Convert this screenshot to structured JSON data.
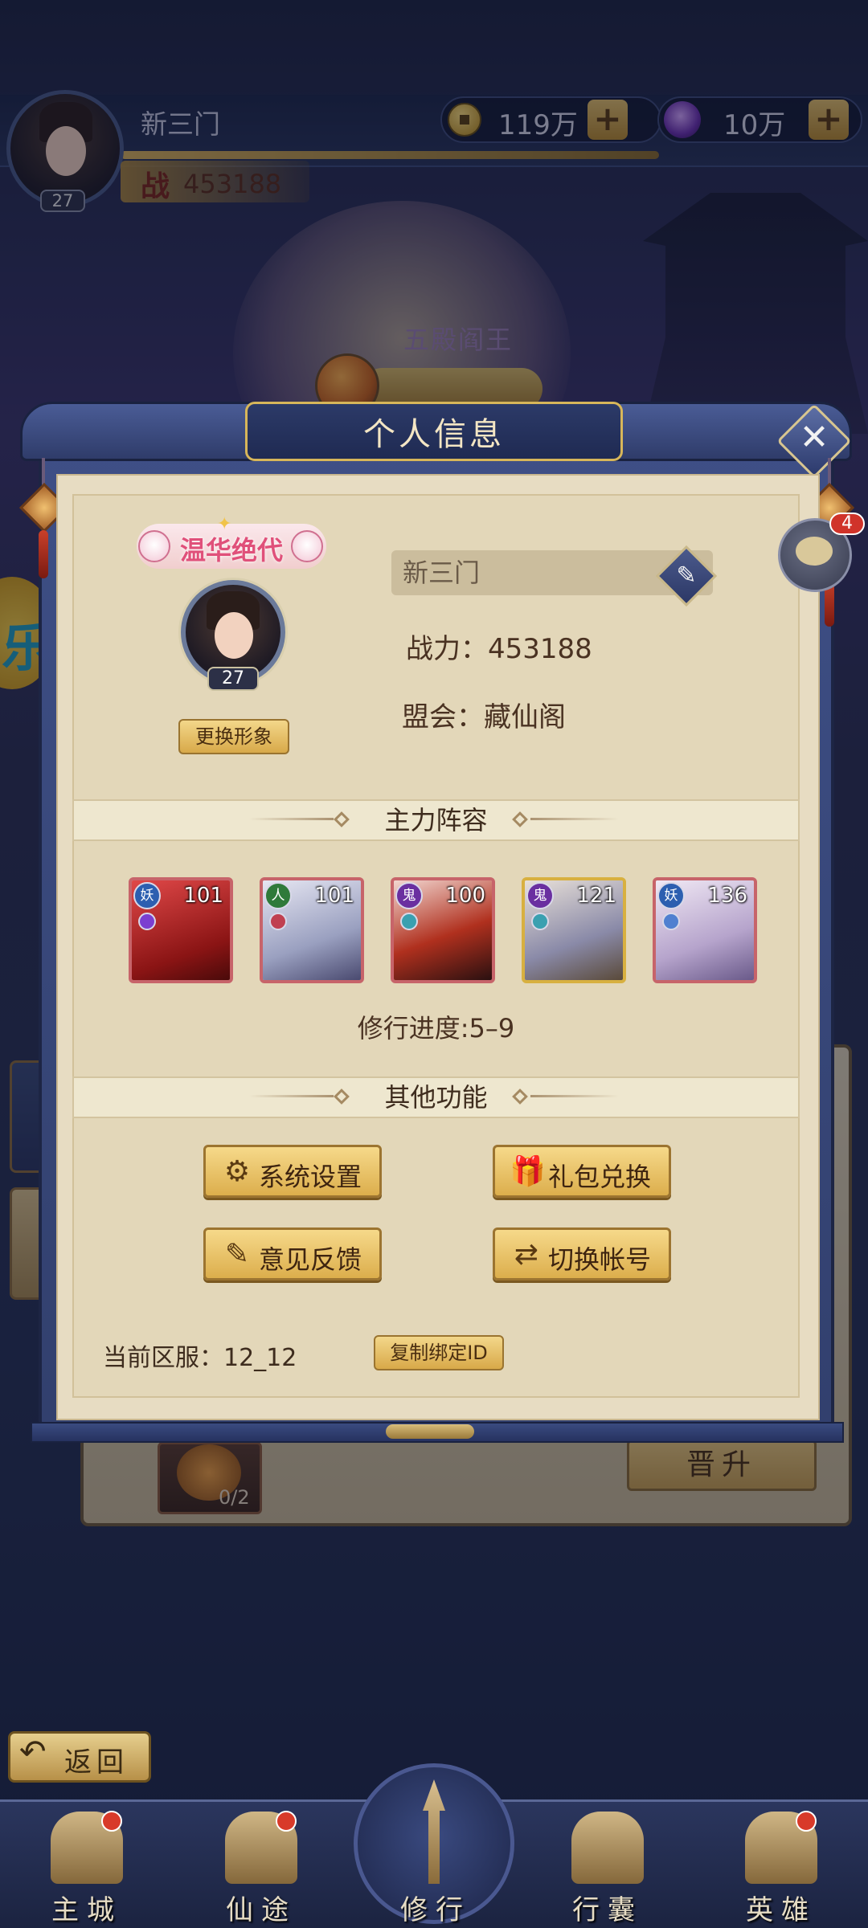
{
  "header": {
    "player_name": "新三门",
    "player_level": "27",
    "power_label": "战",
    "power_value": "453188",
    "coins": "119万",
    "gems": "10万",
    "plus": "+"
  },
  "background": {
    "boss_name": "五殿阎王",
    "plus_slot_count": "0/2",
    "promote_label": "晋升"
  },
  "modal": {
    "title": "个人信息",
    "close": "✕",
    "chat_badge_count": "4",
    "profile": {
      "title_badge": "温华绝代",
      "level": "27",
      "change_look": "更换形象",
      "name": "新三门",
      "power_line": "战力：453188",
      "guild_line": "盟会：藏仙阁"
    },
    "lineup": {
      "header": "主力阵容",
      "heroes": [
        {
          "level": "101",
          "faction": "妖",
          "faction_color": "#2c5fb0",
          "frame": "red"
        },
        {
          "level": "101",
          "faction": "人",
          "faction_color": "#2f7a3a",
          "frame": "red"
        },
        {
          "level": "100",
          "faction": "鬼",
          "faction_color": "#6a2fa0",
          "frame": "red"
        },
        {
          "level": "121",
          "faction": "鬼",
          "faction_color": "#6a2fa0",
          "frame": "gold"
        },
        {
          "level": "136",
          "faction": "妖",
          "faction_color": "#2c5fb0",
          "frame": "red"
        }
      ],
      "progress": "修行进度:5–9"
    },
    "other": {
      "header": "其他功能",
      "buttons": [
        {
          "label": "系统设置",
          "icon": "gear-icon",
          "glyph": "⚙"
        },
        {
          "label": "礼包兑换",
          "icon": "gift-icon",
          "glyph": "🎁"
        },
        {
          "label": "意见反馈",
          "icon": "pencil-icon",
          "glyph": "✎"
        },
        {
          "label": "切换帐号",
          "icon": "swap-icon",
          "glyph": "⇄"
        }
      ]
    },
    "server": {
      "label": "当前区服：12_12",
      "copy_button": "复制绑定ID"
    }
  },
  "bottom": {
    "back": "返回",
    "back_arrow": "↶",
    "nav": [
      {
        "label": "主城",
        "badge": true
      },
      {
        "label": "仙途",
        "badge": true
      },
      {
        "label": "修行",
        "badge": false
      },
      {
        "label": "行囊",
        "badge": false
      },
      {
        "label": "英雄",
        "badge": true
      }
    ]
  },
  "colors": {
    "accent_gold": "#d8a949",
    "frame_blue": "#3e4f86",
    "parchment": "#e7dcc2",
    "badge_red": "#d0332a"
  }
}
